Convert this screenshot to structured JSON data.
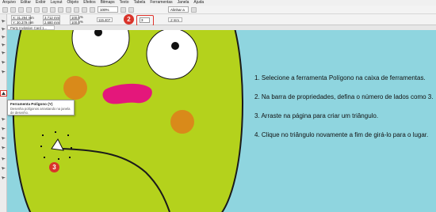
{
  "menu": [
    "Arquivo",
    "Editar",
    "Exibir",
    "Layout",
    "Objeto",
    "Efeitos",
    "Bitmaps",
    "Texto",
    "Tabela",
    "Ferramentas",
    "Janela",
    "Ajuda"
  ],
  "toolbar": {
    "zoom": "100%",
    "snap_label": "Alinhar a"
  },
  "property_bar": {
    "x": "X: 31.294 mm",
    "y": "Y: 30.379 mm",
    "width": "3.712 mm",
    "height": "2.680 mm",
    "scale_x": "100.0",
    "scale_y": "100.0",
    "percent": "%",
    "angle": "115.407",
    "sides": "3",
    "outline": ".2 mm"
  },
  "document_tab": "Party Invitation Card 1...",
  "tooltip": {
    "title": "Ferramenta Polígono (Y)",
    "description": "Desenha polígonos arrastando na janela de desenho."
  },
  "badges": [
    "1",
    "2",
    "3"
  ],
  "instructions": [
    "1. Selecione a ferramenta Polígono na caixa de ferramentas.",
    "2. Na barra de propriedades, defina o número de lados como 3.",
    "3. Arraste na página para criar um triângulo.",
    "4. Clique no triângulo novamente a fim de girá-lo para o lugar."
  ],
  "colors": {
    "canvas": "#8fd5df",
    "character_body": "#b4d21c",
    "cheek": "#d98a1a",
    "mouth_top": "#e4177b",
    "highlight": "#e0332b"
  },
  "icons": [
    "pick-tool-icon",
    "shape-tool-icon",
    "crop-tool-icon",
    "zoom-tool-icon",
    "freehand-tool-icon",
    "rectangle-tool-icon",
    "ellipse-tool-icon",
    "polygon-tool-icon",
    "text-tool-icon",
    "fill-tool-icon"
  ]
}
